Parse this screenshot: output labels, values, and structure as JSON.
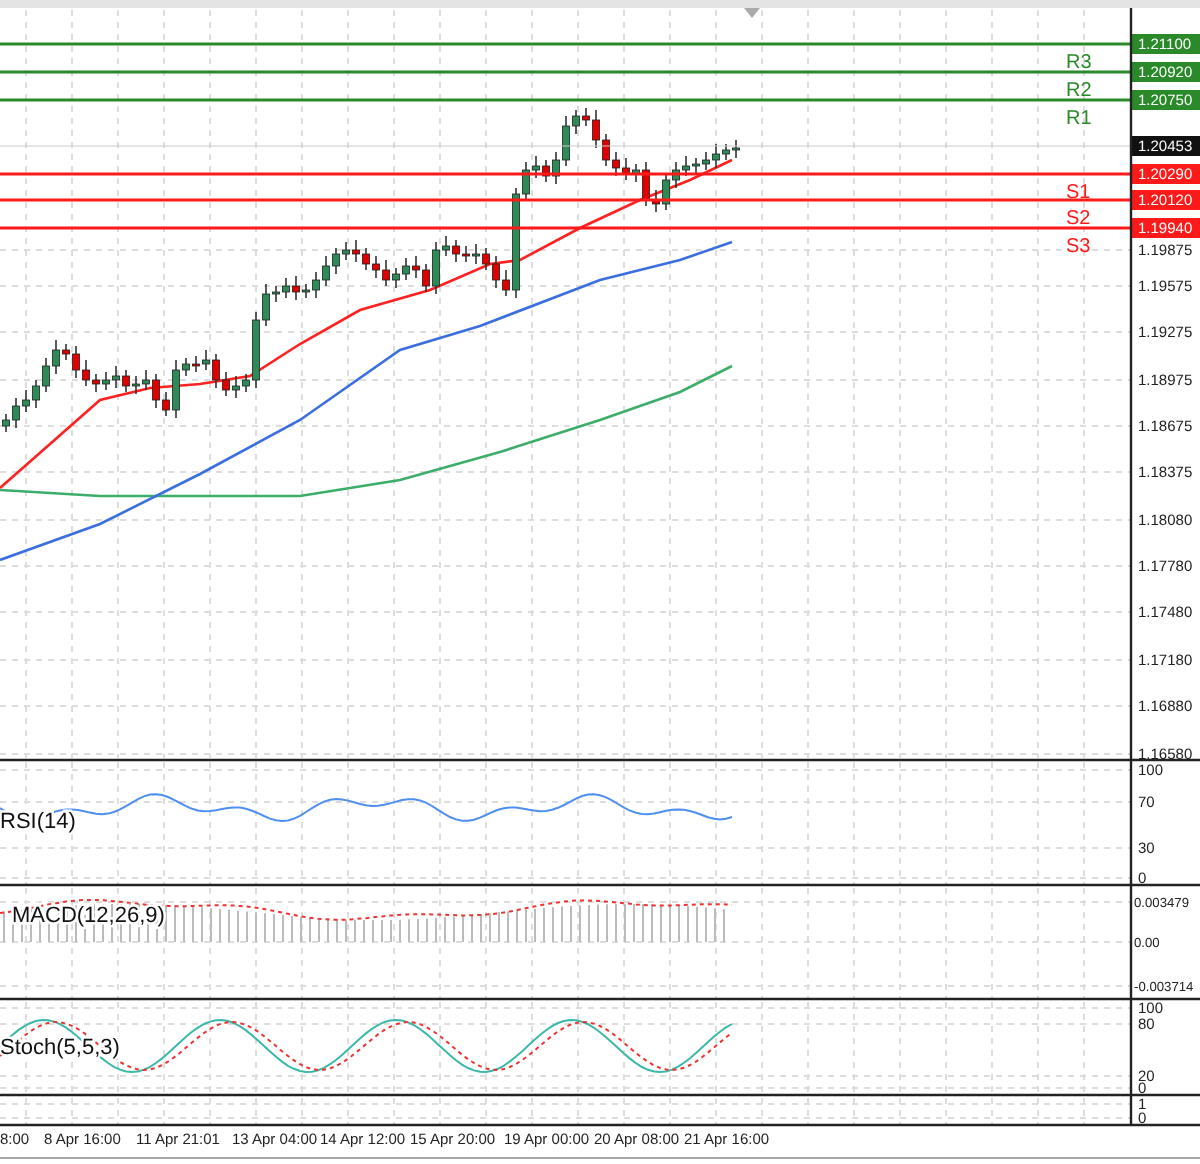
{
  "price_chart": {
    "levels": [
      {
        "label": "R3",
        "price": "1.21100",
        "kind": "resistance"
      },
      {
        "label": "R2",
        "price": "1.20920",
        "kind": "resistance"
      },
      {
        "label": "R1",
        "price": "1.20750",
        "kind": "resistance"
      },
      {
        "label": "S1",
        "price": "1.20290",
        "kind": "support"
      },
      {
        "label": "S2",
        "price": "1.20120",
        "kind": "support"
      },
      {
        "label": "S3",
        "price": "1.19940",
        "kind": "support"
      }
    ],
    "current_price": "1.20453",
    "price_axis": [
      "1.19875",
      "1.19575",
      "1.19275",
      "1.18975",
      "1.18675",
      "1.18375",
      "1.18080",
      "1.17780",
      "1.17480",
      "1.17180",
      "1.16880",
      "1.16580"
    ]
  },
  "indicators": [
    {
      "kind": "rsi",
      "label": "RSI(14)",
      "axis": [
        "100",
        "70",
        "30",
        "0"
      ]
    },
    {
      "kind": "macd",
      "label": "MACD(12,26,9)",
      "axis": [
        "0.003479",
        "0.00",
        "-0.003714"
      ]
    },
    {
      "kind": "stoch",
      "label": "Stoch(5,5,3)",
      "axis": [
        "100",
        "80",
        "20",
        "0"
      ]
    },
    {
      "kind": "empty",
      "axis": [
        "1",
        "0"
      ]
    }
  ],
  "time_axis": [
    "8:00",
    "8 Apr 16:00",
    "11 Apr 21:01",
    "13 Apr 04:00",
    "14 Apr 12:00",
    "15 Apr 20:00",
    "19 Apr 00:00",
    "20 Apr 08:00",
    "21 Apr 16:00"
  ]
}
